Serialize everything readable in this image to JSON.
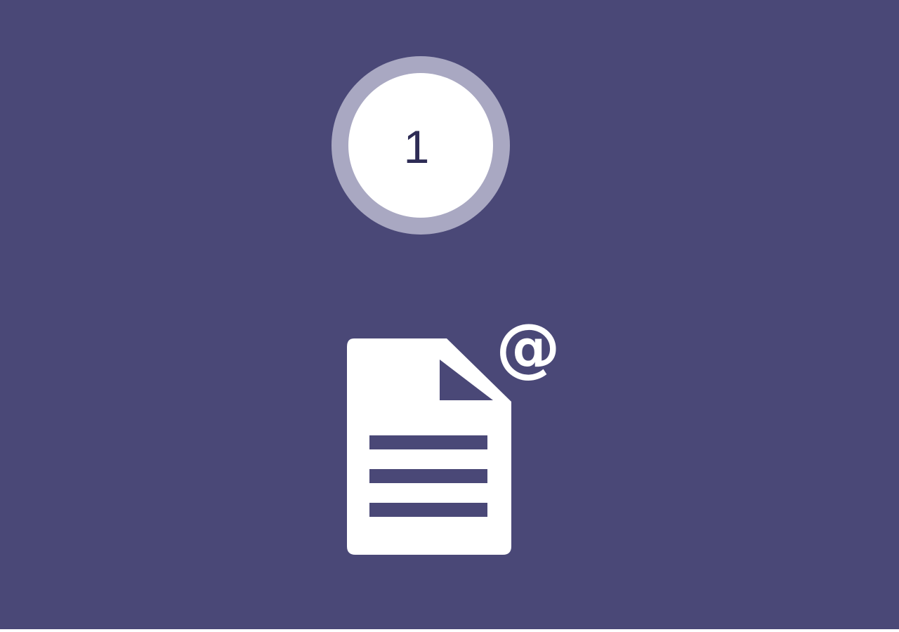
{
  "step": {
    "number": "1"
  },
  "icon": {
    "name": "document-mention-icon",
    "at_symbol": "@"
  },
  "colors": {
    "background": "#4a4877",
    "ring": "#a9a8c2",
    "circle": "#ffffff",
    "number": "#2e2c55",
    "icon": "#ffffff"
  }
}
